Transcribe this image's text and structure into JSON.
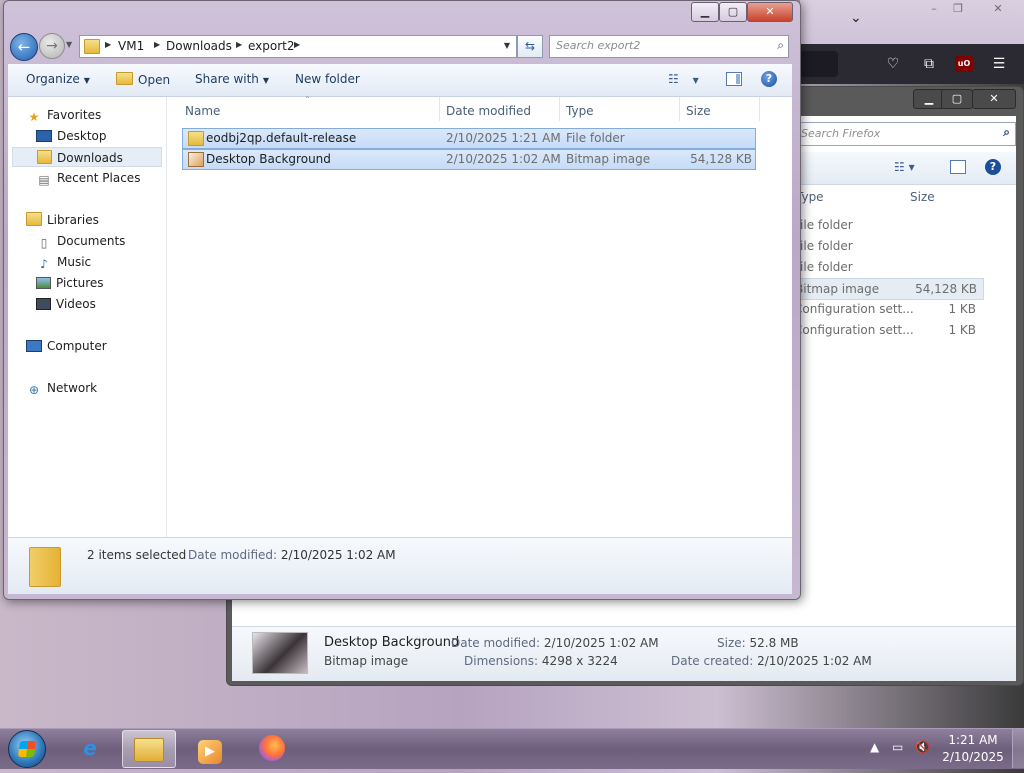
{
  "firefox": {
    "menu_icon": "☰",
    "ublock_label": "uO",
    "window_controls": {
      "minimize": "–",
      "maximize": "❐",
      "close": "✕"
    }
  },
  "background_window": {
    "search_placeholder": "Search Firefox",
    "columns": {
      "type": "Type",
      "size": "Size"
    },
    "rows": [
      {
        "type": "File folder",
        "size": ""
      },
      {
        "type": "File folder",
        "size": ""
      },
      {
        "type": "File folder",
        "size": ""
      },
      {
        "type": "Bitmap image",
        "size": "54,128 KB"
      },
      {
        "type": "Configuration sett...",
        "size": "1 KB"
      },
      {
        "type": "Configuration sett...",
        "size": "1 KB"
      }
    ],
    "details": {
      "name": "Desktop Background",
      "kind": "Bitmap image",
      "date_modified_label": "Date modified:",
      "date_modified": "2/10/2025 1:02 AM",
      "dimensions_label": "Dimensions:",
      "dimensions": "4298 x 3224",
      "size_label": "Size:",
      "size": "52.8 MB",
      "date_created_label": "Date created:",
      "date_created": "2/10/2025 1:02 AM"
    }
  },
  "window": {
    "controls": {
      "minimize": "▁",
      "maximize": "▢",
      "close": "✕"
    },
    "address": {
      "crumbs": [
        "VM1",
        "Downloads",
        "export2"
      ]
    },
    "search_placeholder": "Search export2",
    "toolbar": {
      "organize": "Organize",
      "open": "Open",
      "share_with": "Share with",
      "new_folder": "New folder"
    },
    "nav": {
      "favorites": "Favorites",
      "desktop": "Desktop",
      "downloads": "Downloads",
      "recent_places": "Recent Places",
      "libraries": "Libraries",
      "documents": "Documents",
      "music": "Music",
      "pictures": "Pictures",
      "videos": "Videos",
      "computer": "Computer",
      "network": "Network"
    },
    "columns": {
      "name": "Name",
      "date_modified": "Date modified",
      "type": "Type",
      "size": "Size"
    },
    "files": [
      {
        "name": "eodbj2qp.default-release",
        "date": "2/10/2025 1:21 AM",
        "type": "File folder",
        "size": "",
        "icon": "folder-icon"
      },
      {
        "name": "Desktop Background",
        "date": "2/10/2025 1:02 AM",
        "type": "Bitmap image",
        "size": "54,128 KB",
        "icon": "bitmap-icon"
      }
    ],
    "status": {
      "count": "2 items selected",
      "date_label": "Date modified:",
      "date": "2/10/2025 1:02 AM"
    }
  },
  "taskbar": {
    "clock_time": "1:21 AM",
    "clock_date": "2/10/2025"
  }
}
